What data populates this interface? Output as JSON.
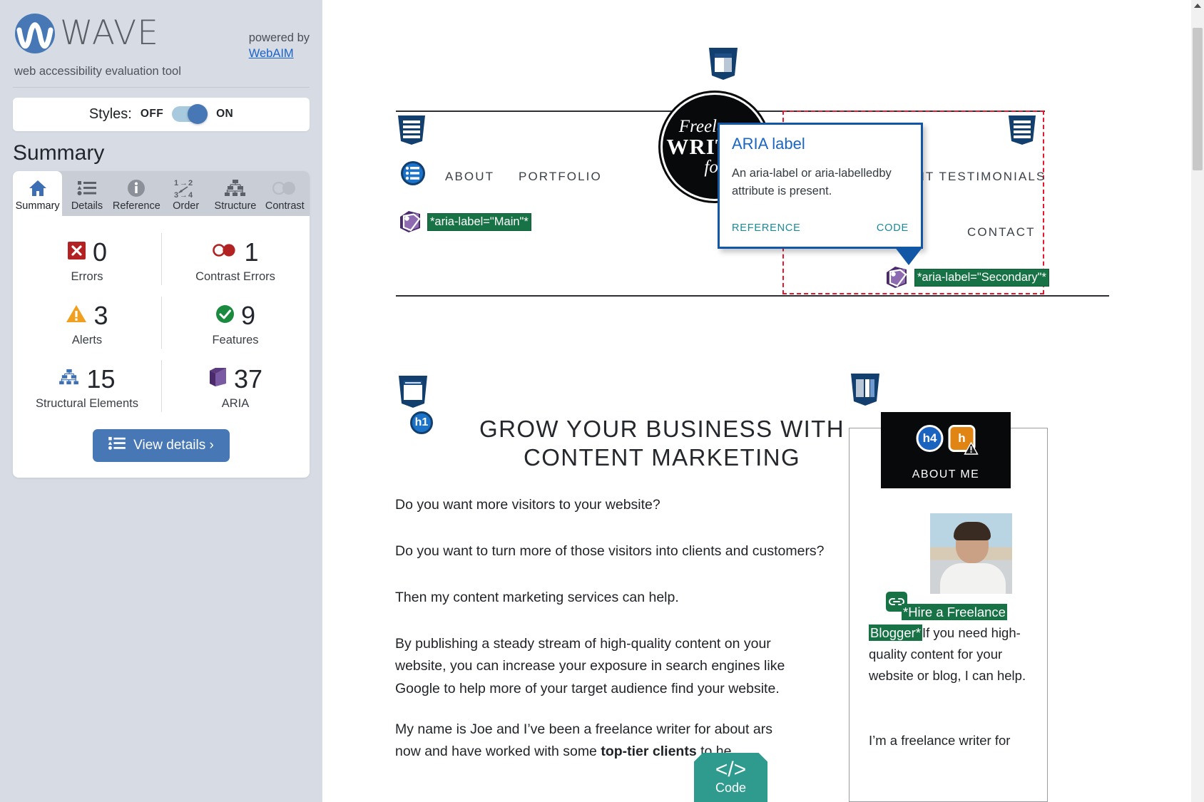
{
  "sidebar": {
    "brand": {
      "name": "WAVE",
      "tagline": "web accessibility evaluation tool"
    },
    "powered": {
      "prefix": "powered by",
      "link": "WebAIM"
    },
    "styles": {
      "label": "Styles:",
      "off": "OFF",
      "on": "ON",
      "state": "ON"
    },
    "summary_title": "Summary",
    "tabs": [
      {
        "label": "Summary",
        "icon": "home-icon",
        "active": true
      },
      {
        "label": "Details",
        "icon": "list-icon",
        "active": false
      },
      {
        "label": "Reference",
        "icon": "info-icon",
        "active": false
      },
      {
        "label": "Order",
        "icon": "order-icon",
        "active": false
      },
      {
        "label": "Structure",
        "icon": "structure-icon",
        "active": false
      },
      {
        "label": "Contrast",
        "icon": "contrast-icon",
        "active": false
      }
    ],
    "tab_order_glyphs": {
      "l1": "1→2",
      "l2": "3→4"
    },
    "stats": [
      {
        "label": "Errors",
        "value": "0",
        "icon": "error-icon",
        "color": "#b22222"
      },
      {
        "label": "Contrast Errors",
        "value": "1",
        "icon": "contrast-icon",
        "color": "#b22222"
      },
      {
        "label": "Alerts",
        "value": "3",
        "icon": "alert-icon",
        "color": "#f0a01e"
      },
      {
        "label": "Features",
        "value": "9",
        "icon": "feature-icon",
        "color": "#1a8a3f"
      },
      {
        "label": "Structural Elements",
        "value": "15",
        "icon": "structure-icon",
        "color": "#3d6fb4"
      },
      {
        "label": "ARIA",
        "value": "37",
        "icon": "aria-icon",
        "color": "#522e74"
      }
    ],
    "view_details": {
      "label": "View details ›",
      "icon": "list-icon"
    }
  },
  "page": {
    "logo": {
      "line1": "Freelance",
      "line2": "WRITER",
      "line3": "for"
    },
    "nav_primary": [
      "ABOUT",
      "PORTFOLIO"
    ],
    "nav_secondary": [
      "ENT TESTIMONIALS",
      "CONTACT"
    ],
    "annotations": {
      "aria_main": "*aria-label=\"Main\"*",
      "aria_secondary": "*aria-label=\"Secondary\"*"
    },
    "heading": {
      "level": "h1",
      "text": "GROW YOUR BUSINESS WITH CONTENT MARKETING"
    },
    "paragraphs": [
      "Do you want more visitors to your website?",
      "Do you want to turn more of those visitors into clients and customers?",
      "Then my content marketing services can help.",
      "By publishing a steady stream of high-quality content on your website, you can increase your exposure in search engines like Google to help more of your target audience find your website."
    ],
    "paragraph_last": {
      "part1": "My name is Joe and I’ve been a freelance writer for about",
      "part2": "ars",
      "line2_a": "now and have worked with some ",
      "line2_bold": "top-tier clients",
      "line2_b": " to he"
    },
    "about_card": {
      "banner_title": "ABOUT ME",
      "h4_badge": "h4",
      "alert_badge": "h",
      "link_text_1": "*Hire a Freelance",
      "link_text_2": "Blogger*",
      "body_inline": "If you need",
      "body_lines": [
        "high-quality content for",
        "your website or blog, I",
        "can help."
      ],
      "body_next": "I’m a freelance writer for"
    },
    "code_button": {
      "glyph": "</>",
      "label": "Code"
    }
  },
  "tooltip": {
    "title": "ARIA label",
    "body": "An aria-label or aria-labelledby attribute is present.",
    "reference": "REFERENCE",
    "code": "CODE"
  },
  "colors": {
    "sidebar_bg": "#d7dbe3",
    "accent_blue": "#4778b5",
    "tooltip_border": "#1257a5",
    "region_red": "#e8162c",
    "aria_green": "#177245",
    "code_teal": "#2f9b8e"
  }
}
